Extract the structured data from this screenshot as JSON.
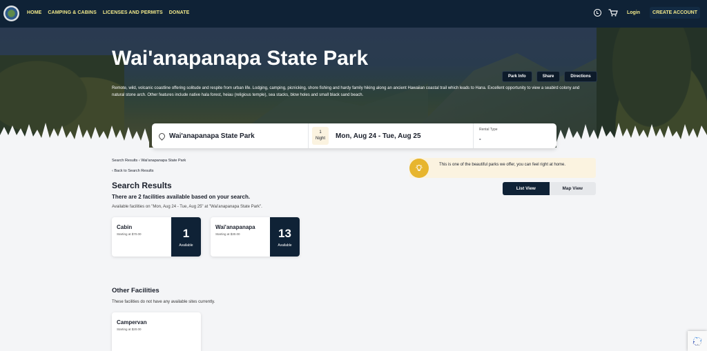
{
  "nav": {
    "links": [
      "HOME",
      "CAMPING & CABINS",
      "LICENSES AND PERMITS",
      "DONATE"
    ],
    "login": "Login",
    "create_account": "CREATE ACCOUNT"
  },
  "hero": {
    "title": "Wai'anapanapa State Park",
    "buttons": [
      "Park Info",
      "Share",
      "Directions"
    ],
    "description": "Remote, wild, volcanic coastline offering solitude and respite from urban life. Lodging, camping, picnicking, shore fishing and hardy family hiking along an ancient Hawaiian coastal trail which leads to Hana. Excellent opportunity to view a seabird colony and natural stone arch. Other features include native hala forest, heiau (religious temple), sea stacks, blow holes and small black sand beach."
  },
  "search": {
    "location": "Wai'anapanapa State Park",
    "nights_count": "1",
    "nights_label": "Night",
    "date_range": "Mon, Aug 24 - Tue, Aug 25",
    "rental_type_label": "Rental Type",
    "rental_type_value": "-"
  },
  "breadcrumb": {
    "parent": "Search Results",
    "current": "Wai'anapanapa State Park"
  },
  "back_link": "Back to Search Results",
  "results": {
    "title": "Search Results",
    "count_text": "There are 2 facilities available based on your search.",
    "subtitle": "Available facilities on \"Mon, Aug 24 - Tue, Aug 25\" at \"Wai'anapanapa State Park\".",
    "facilities": [
      {
        "name": "Cabin",
        "price": "Starting at $70.00",
        "available": "1",
        "available_label": "Available"
      },
      {
        "name": "Wai'anapanapa",
        "price": "Starting at $30.00",
        "available": "13",
        "available_label": "Available"
      }
    ]
  },
  "tip": {
    "text": "This is one of the beautiful parks we offer, you can feel right at home."
  },
  "view_toggle": {
    "list": "List View",
    "map": "Map View",
    "active": "list"
  },
  "other": {
    "title": "Other Facilities",
    "subtitle": "These facilities do not have any available sites currently.",
    "facilities": [
      {
        "name": "Campervan",
        "price": "Starting at $20.00"
      }
    ]
  },
  "colors": {
    "nav_bg": "#0f2236",
    "nav_link": "#f2e98a",
    "tip_bg": "#fbf3e0",
    "bulb": "#e7b52e"
  }
}
